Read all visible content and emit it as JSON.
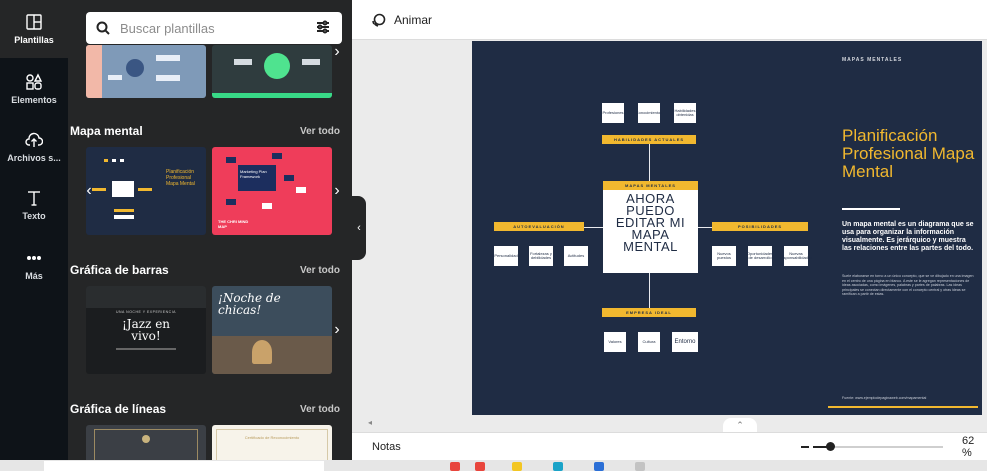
{
  "sidebar": {
    "items": [
      {
        "label": "Plantillas",
        "icon": "templates-icon",
        "active": true
      },
      {
        "label": "Elementos",
        "icon": "elements-icon",
        "active": false
      },
      {
        "label": "Archivos s...",
        "icon": "upload-cloud-icon",
        "active": false
      },
      {
        "label": "Texto",
        "icon": "text-icon",
        "active": false
      },
      {
        "label": "Más",
        "icon": "more-icon",
        "active": false
      }
    ]
  },
  "search": {
    "placeholder": "Buscar plantillas",
    "value": ""
  },
  "sections": [
    {
      "title": "Mapa mental",
      "link": "Ver todo"
    },
    {
      "title": "Gráfica de barras",
      "link": "Ver todo"
    },
    {
      "title": "Gráfica de líneas",
      "link": "Ver todo"
    }
  ],
  "thumbnails": {
    "mind1": {
      "title": "Planificación Profesional Mapa Mental"
    },
    "mind2": {
      "title": "Marketing Plan Framework",
      "footer": "THE CHRI MIND MAP"
    },
    "bar1": {
      "kicker": "UNA NOCHE Y EXPERIENCIA",
      "title": "¡Jazz en vivo!"
    },
    "bar2": {
      "title": "¡Noche de chicas!"
    },
    "line2": {
      "title": "Certificado de Reconocimiento"
    }
  },
  "toolbar": {
    "animate_label": "Animar"
  },
  "document": {
    "header_label": "MAPAS MENTALES",
    "title": "Planificación Profesional Mapa Mental",
    "description": "Un mapa mental es un diagrama que se usa para organizar la información visualmente. Es jerárquico y muestra las relaciones entre las partes del todo.",
    "body": "Suele elaborarse en torno a un único concepto, que se ve dibujado en una imagen en el centro de una página en blanco. A este se le agregan representaciones de ideas asociadas, como imágenes, palabras y partes de palabras. Las ideas principales se conectan directamente con el concepto central y otras ideas se ramifican a partir de estas.",
    "source": "Fuente: www.ejemplodepaginaweb.com/mapamental",
    "center_text": [
      "AHORA",
      "PUEDO",
      "EDITAR MI",
      "MAPA",
      "MENTAL"
    ],
    "center_label": "MAPAS MENTALES",
    "top_label": "HABILIDADES ACTUALES",
    "top_items": [
      "Profesiones",
      "Conocimientos",
      "Habilidades obtenidas"
    ],
    "left_label": "AUTOEVALUACIÓN",
    "left_items": [
      "Personalidad",
      "Fortalezas y debilidades",
      "Actitudes"
    ],
    "right_label": "POSIBILIDADES",
    "right_items": [
      "Nuevos puestos",
      "Oportunidades de desarrollo",
      "Nuevas responsabilidades"
    ],
    "bottom_label": "EMPRESA IDEAL",
    "bottom_items": [
      "Valores",
      "Cultura",
      "Entorno"
    ]
  },
  "footer": {
    "notes_label": "Notas",
    "zoom_label": "62 %",
    "zoom_value": 0.62
  },
  "colors": {
    "navy": "#1f2c44",
    "gold": "#f1b82f",
    "panel": "#252627",
    "rail": "#0e1318"
  }
}
